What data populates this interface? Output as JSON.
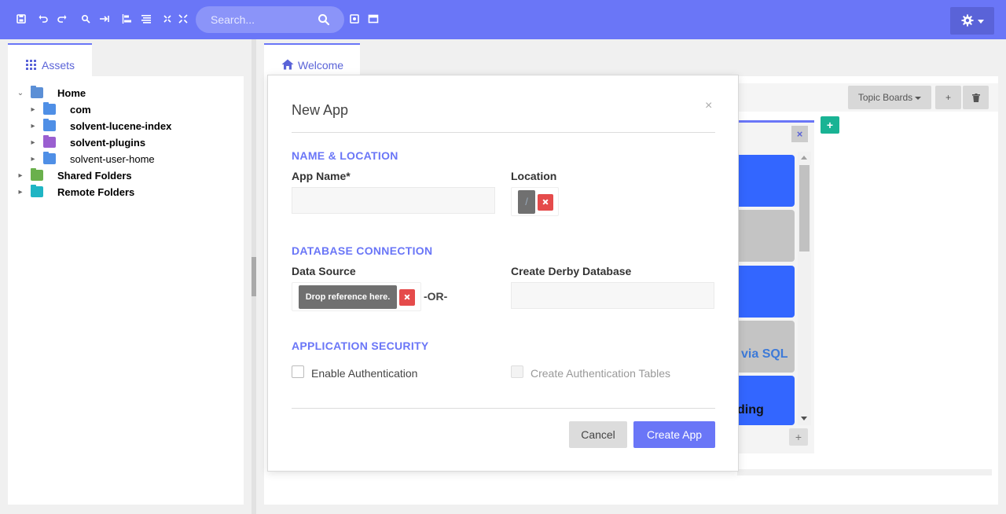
{
  "toolbar": {
    "icons": [
      "save-icon",
      "undo-icon",
      "redo-icon",
      "find-icon",
      "goto-icon",
      "align-left-icon",
      "align-justify-icon",
      "expand-icon",
      "collapse-icon",
      "screenshot-icon",
      "window-icon"
    ],
    "search_placeholder": "Search...",
    "settings_icon": "gear-icon"
  },
  "left_panel": {
    "tab_label": "Assets",
    "tree": [
      {
        "label": "Home",
        "bold": true,
        "expanded": true,
        "icon": "home-folder-icon"
      },
      {
        "label": "com",
        "bold": true,
        "icon": "folder-icon"
      },
      {
        "label": "solvent-lucene-index",
        "bold": true,
        "icon": "folder-icon"
      },
      {
        "label": "solvent-plugins",
        "bold": true,
        "icon": "plugin-folder-icon"
      },
      {
        "label": "solvent-user-home",
        "bold": false,
        "icon": "user-folder-icon"
      },
      {
        "label": "Shared Folders",
        "bold": true,
        "icon": "shared-folder-icon"
      },
      {
        "label": "Remote Folders",
        "bold": true,
        "icon": "remote-folder-icon"
      }
    ]
  },
  "workspace": {
    "tab_label": "Welcome",
    "topic_boards_label": "Topic Boards",
    "add_label": "+",
    "board_add_label": "+",
    "green_add_label": "+",
    "board_close_label": "×",
    "card_texts": [
      "via SQL",
      "ding"
    ]
  },
  "modal": {
    "title": "New App",
    "close": "×",
    "sections": {
      "name_location": "NAME & LOCATION",
      "database": "DATABASE CONNECTION",
      "security": "APPLICATION SECURITY"
    },
    "app_name_label": "App Name*",
    "app_name_value": "",
    "location_label": "Location",
    "location_value": "/",
    "data_source_label": "Data Source",
    "drop_reference": "Drop reference here.",
    "or_text": "-OR-",
    "derby_label": "Create Derby Database",
    "derby_value": "",
    "enable_auth_label": "Enable Authentication",
    "create_auth_tables_label": "Create Authentication Tables",
    "cancel_label": "Cancel",
    "create_label": "Create App"
  },
  "colors": {
    "accent": "#6a76f7",
    "card_blue": "#3366ff",
    "card_gray": "#c4c4c4",
    "danger": "#e54b4b",
    "green": "#19b394"
  }
}
